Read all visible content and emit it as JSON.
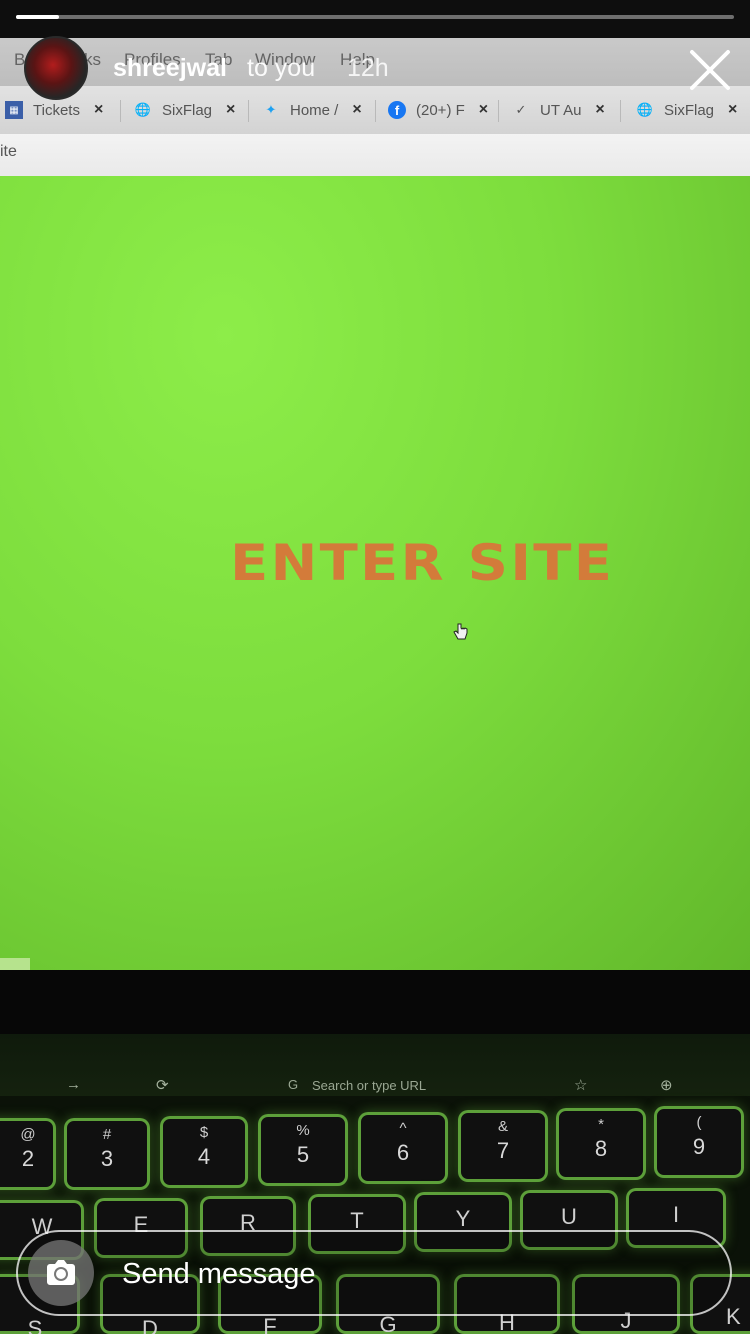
{
  "story": {
    "progress": 0.06,
    "username": "shreejwal",
    "to_label": "to you",
    "time": "12h",
    "send_placeholder": "Send message"
  },
  "menubar": {
    "items": [
      "Bo",
      "ks",
      "Profiles",
      "Tab",
      "Window",
      "Help"
    ]
  },
  "browser": {
    "tabs": [
      {
        "label": "Tickets",
        "icon": "grid-favicon-icon"
      },
      {
        "label": "SixFlag",
        "icon": "globe-icon"
      },
      {
        "label": "Home /",
        "icon": "twitter-bird-icon"
      },
      {
        "label": "(20+) F",
        "icon": "facebook-icon"
      },
      {
        "label": "UT Au",
        "icon": "ut-logo-icon"
      },
      {
        "label": "SixFlag",
        "icon": "globe-icon"
      }
    ],
    "url_text": "ite"
  },
  "page": {
    "heading": "ENTER SITE",
    "background": "#7ddd3d",
    "heading_color": "#d37b3a"
  },
  "touchbar": {
    "search_text": "Search or type URL"
  },
  "keyboard": {
    "number_row": [
      {
        "top": "@",
        "main": "2"
      },
      {
        "top": "#",
        "main": "3"
      },
      {
        "top": "$",
        "main": "4"
      },
      {
        "top": "%",
        "main": "5"
      },
      {
        "top": "^",
        "main": "6"
      },
      {
        "top": "&",
        "main": "7"
      },
      {
        "top": "*",
        "main": "8"
      },
      {
        "top": "(",
        "main": "9"
      }
    ],
    "letter_row": [
      "W",
      "E",
      "R",
      "T",
      "Y",
      "U",
      "I"
    ],
    "bottom_row": [
      "S",
      "D",
      "F",
      "G",
      "H",
      "J",
      "K"
    ]
  }
}
